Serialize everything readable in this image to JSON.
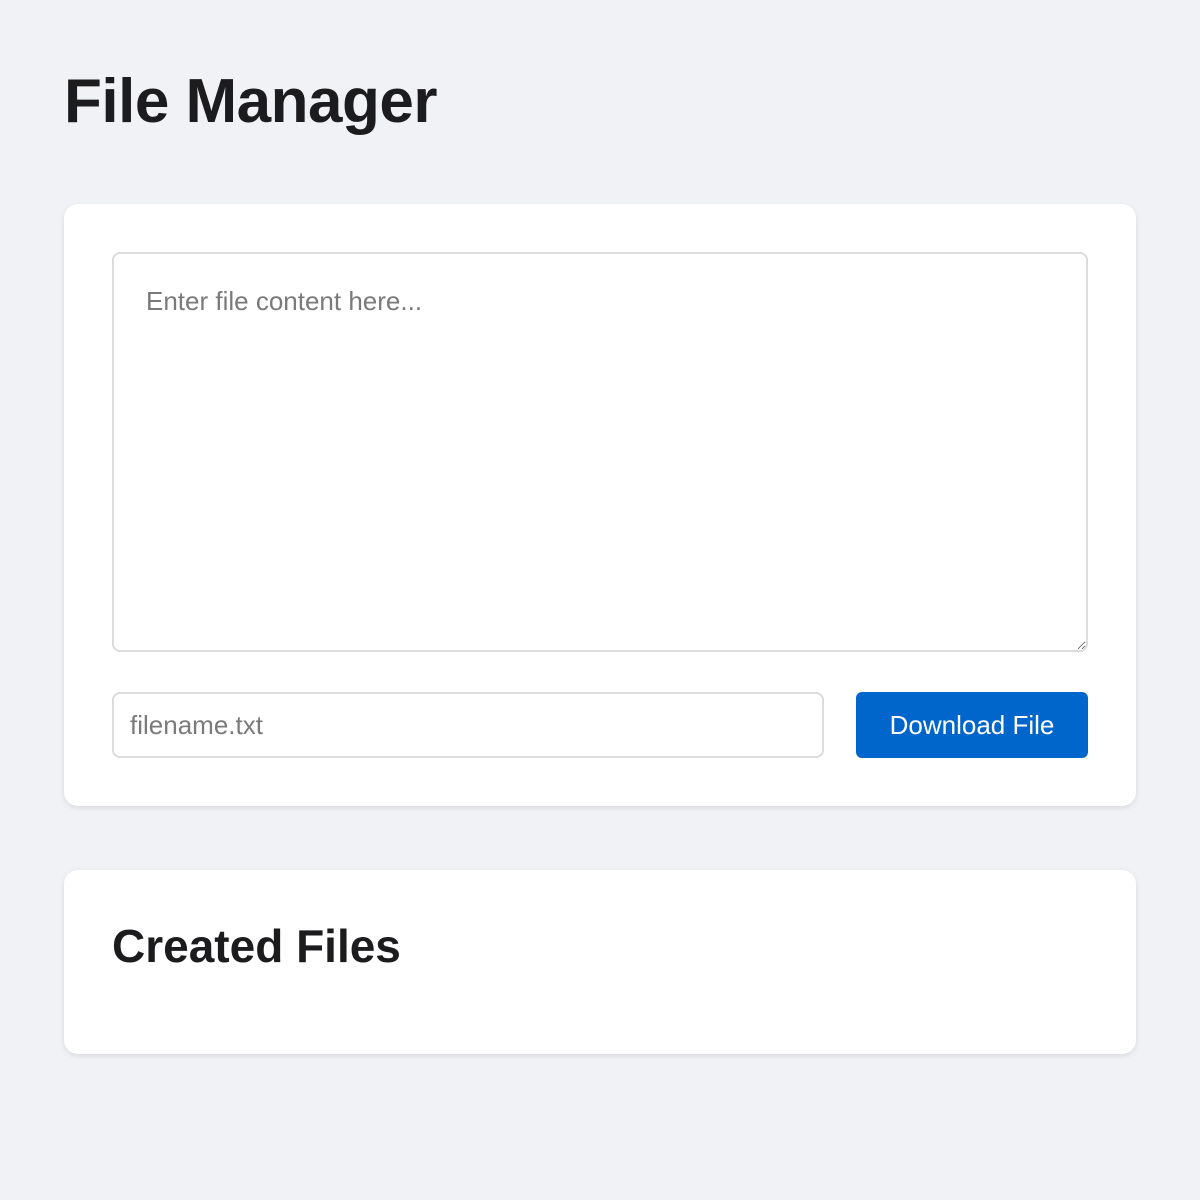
{
  "header": {
    "title": "File Manager"
  },
  "editor": {
    "content_placeholder": "Enter file content here...",
    "content_value": "",
    "filename_placeholder": "filename.txt",
    "filename_value": "",
    "download_label": "Download File"
  },
  "files": {
    "title": "Created Files",
    "items": []
  },
  "colors": {
    "background": "#f0f2f5",
    "card": "#ffffff",
    "accent": "#0066cc",
    "text": "#1c1c1e",
    "placeholder": "#7a7a7a",
    "border": "#dcdcdc"
  }
}
